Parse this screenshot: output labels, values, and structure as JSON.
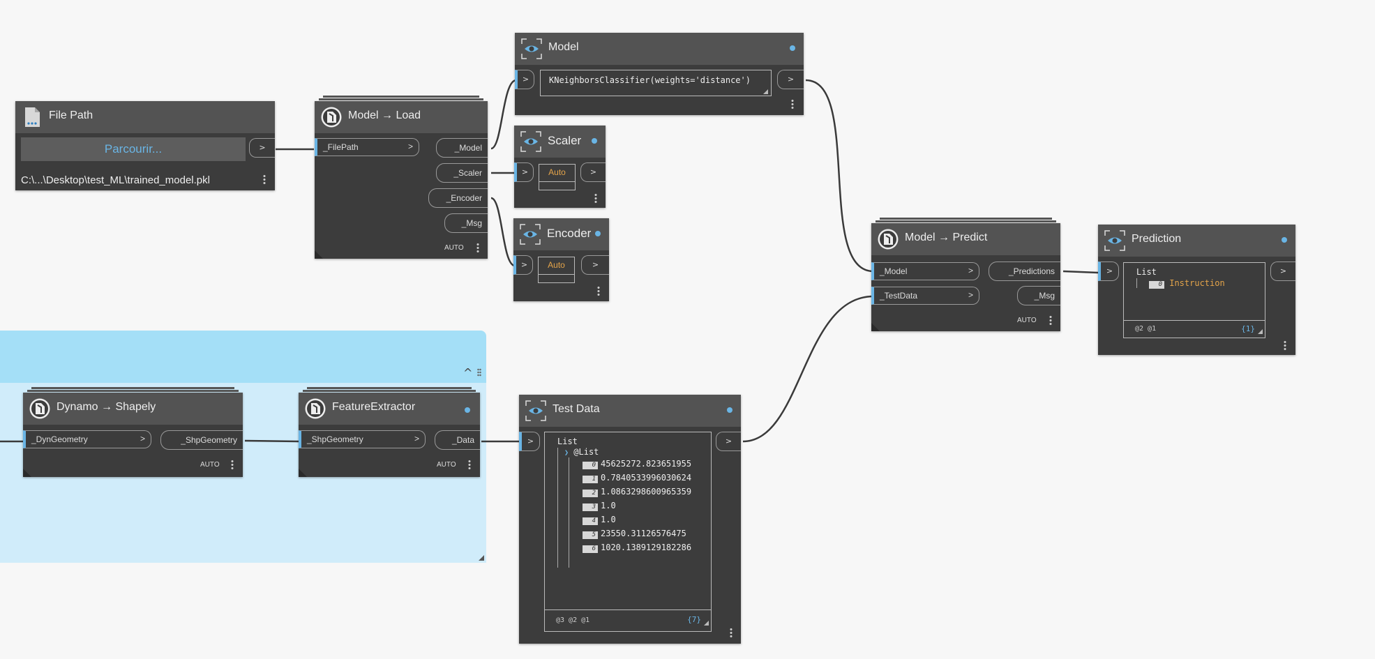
{
  "group": {
    "collapse_glyph": "^"
  },
  "nodes": {
    "file_path": {
      "title": "File Path",
      "icon": "file-icon",
      "browse_label": "Parcourir...",
      "path": "C:\\...\\Desktop\\test_ML\\trained_model.pkl",
      "out_glyph": ">"
    },
    "model_load": {
      "title": "Model → Load",
      "icon": "python-script-icon",
      "inputs": [
        {
          "label": "_FilePath",
          "glyph": ">"
        }
      ],
      "outputs": [
        "_Model",
        "_Scaler",
        "_Encoder",
        "_Msg"
      ],
      "lacing": "AUTO"
    },
    "model_watch": {
      "title": "Model",
      "icon": "watch-eye-icon",
      "value": "KNeighborsClassifier(weights='distance')",
      "in_glyph": ">",
      "out_glyph": ">"
    },
    "scaler_watch": {
      "title": "Scaler",
      "icon": "watch-eye-icon",
      "value": "Auto",
      "in_glyph": ">",
      "out_glyph": ">"
    },
    "encoder_watch": {
      "title": "Encoder",
      "icon": "watch-eye-icon",
      "value": "Auto",
      "in_glyph": ">",
      "out_glyph": ">"
    },
    "model_predict": {
      "title": "Model → Predict",
      "icon": "python-script-icon",
      "inputs": [
        {
          "label": "_Model",
          "glyph": ">"
        },
        {
          "label": "_TestData",
          "glyph": ">"
        }
      ],
      "outputs": [
        "_Predictions",
        "_Msg"
      ],
      "lacing": "AUTO"
    },
    "prediction_watch": {
      "title": "Prediction",
      "icon": "watch-eye-icon",
      "list_label": "List",
      "items": [
        {
          "index": "0",
          "value": "Instruction"
        }
      ],
      "levels": "@2 @1",
      "count": "{1}",
      "in_glyph": ">",
      "out_glyph": ">"
    },
    "dynamo_shapely": {
      "title": "Dynamo → Shapely",
      "icon": "python-script-icon",
      "inputs": [
        {
          "label": "_DynGeometry",
          "glyph": ">"
        }
      ],
      "outputs": [
        "_ShpGeometry"
      ],
      "lacing": "AUTO"
    },
    "feature_extractor": {
      "title": "FeatureExtractor",
      "icon": "python-script-icon",
      "inputs": [
        {
          "label": "_ShpGeometry",
          "glyph": ">"
        }
      ],
      "outputs": [
        "_Data"
      ],
      "lacing": "AUTO"
    },
    "test_data": {
      "title": "Test Data",
      "icon": "watch-eye-icon",
      "list_label": "List",
      "sublist_label": "@List",
      "sublist_glyph": "❯",
      "items": [
        {
          "index": "0",
          "value": "45625272.823651955"
        },
        {
          "index": "1",
          "value": "0.7840533996030624"
        },
        {
          "index": "2",
          "value": "1.0863298600965359"
        },
        {
          "index": "3",
          "value": "1.0"
        },
        {
          "index": "4",
          "value": "1.0"
        },
        {
          "index": "5",
          "value": "23550.31126576475"
        },
        {
          "index": "6",
          "value": "1020.1389129182286"
        }
      ],
      "levels": "@3 @2 @1",
      "count": "{7}",
      "in_glyph": ">",
      "out_glyph": ">"
    }
  },
  "colors": {
    "canvas": "#f7f7f7",
    "node_body": "#3c3c3c",
    "node_header": "#535353",
    "accent": "#6ab5e5",
    "group_header": "#a4dff7",
    "group_body": "#d0ecfa",
    "auto_value": "#e4a44a",
    "wire": "#3a3a3a"
  }
}
